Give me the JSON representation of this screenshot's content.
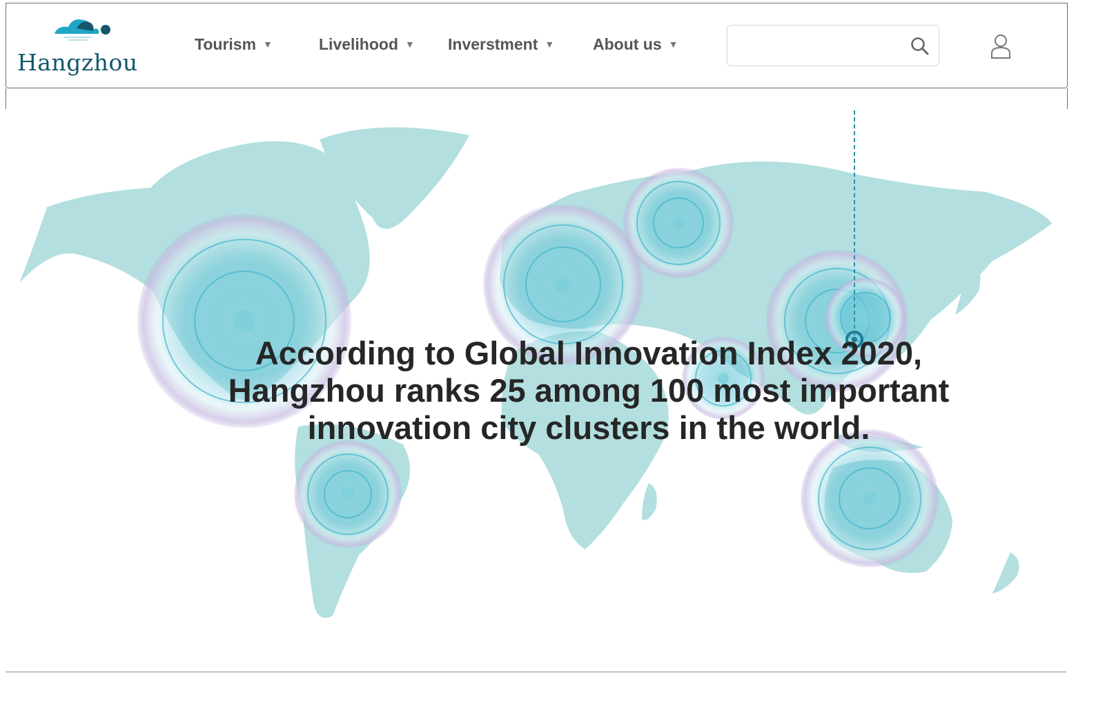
{
  "brand": {
    "name": "Hangzhou",
    "color": "#14566b",
    "accent": "#1ea6c4"
  },
  "nav": [
    {
      "label": "Tourism",
      "caret": "▼"
    },
    {
      "label": "Livelihood",
      "caret": "▼"
    },
    {
      "label": "Inverstment",
      "caret": "▼"
    },
    {
      "label": "About us",
      "caret": "▼"
    }
  ],
  "search": {
    "placeholder": "",
    "icon": "search-icon"
  },
  "user": {
    "icon": "user-icon"
  },
  "hero": {
    "headline": "According to Global Innovation Index 2020, Hangzhou ranks 25 among 100 most important innovation city clusters in the world.",
    "map_color": "#b3dfe0",
    "ring_color": "#3fb6cc",
    "halo_color": "#b8a8d8",
    "hotspot_count": 8
  }
}
